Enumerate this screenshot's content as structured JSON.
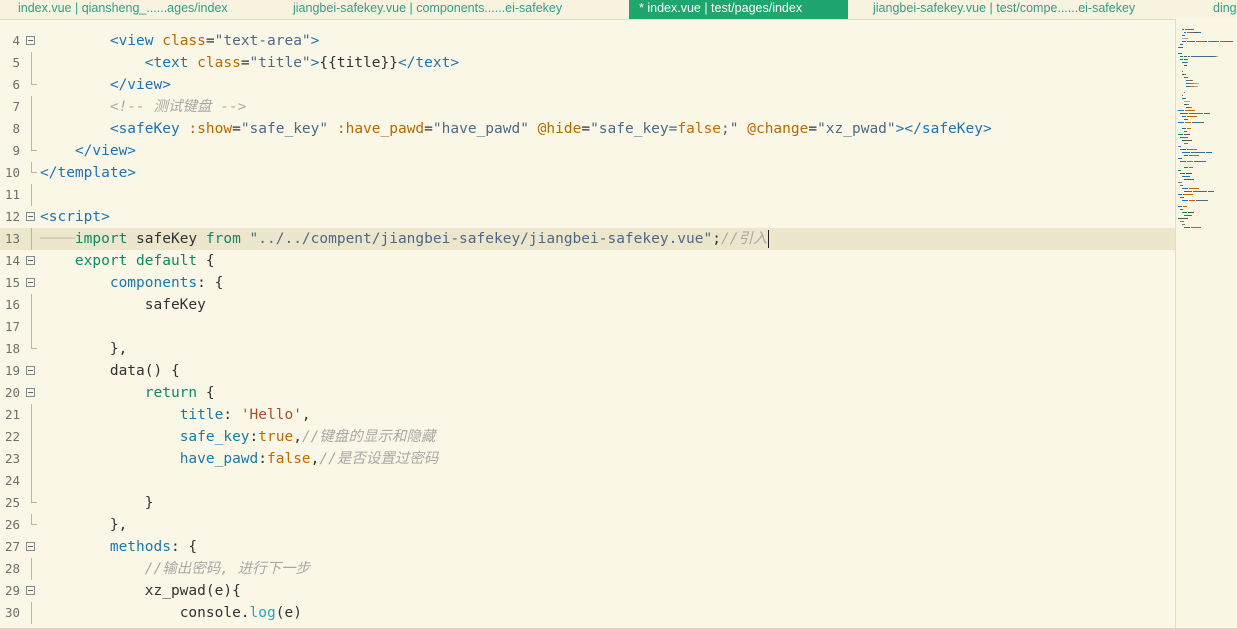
{
  "tabs": [
    {
      "label": "index.vue | qiansheng_......ages/index",
      "active": false
    },
    {
      "label": "jiangbei-safekey.vue | components......ei-safekey",
      "active": false
    },
    {
      "label": "* index.vue | test/pages/index",
      "active": true
    },
    {
      "label": "jiangbei-safekey.vue | test/compe......ei-safekey",
      "active": false
    },
    {
      "label": "ding",
      "active": false
    }
  ],
  "colors": {
    "background": "#fbf7e6",
    "active_tab": "#1ea66d",
    "tag": "#1a74b5",
    "attribute": "#b36a00",
    "string": "#4b6a87",
    "comment": "#a8a8a8",
    "keyword": "#0a8a66",
    "current_line": "#ece6cc"
  },
  "editor": {
    "current_line": "13",
    "lines": [
      {
        "num": "4",
        "indent": "        ",
        "fold": true,
        "tokens": [
          [
            "t-tag",
            "<view"
          ],
          [
            "t-punc",
            " "
          ],
          [
            "t-attr",
            "class"
          ],
          [
            "t-punc",
            "="
          ],
          [
            "t-str",
            "\"text-area\""
          ],
          [
            "t-tag",
            ">"
          ]
        ]
      },
      {
        "num": "5",
        "indent": "            ",
        "fold": false,
        "tokens": [
          [
            "t-tag",
            "<text"
          ],
          [
            "t-punc",
            " "
          ],
          [
            "t-attr",
            "class"
          ],
          [
            "t-punc",
            "="
          ],
          [
            "t-str",
            "\"title\""
          ],
          [
            "t-tag",
            ">"
          ],
          [
            "t-id",
            "{{title}}"
          ],
          [
            "t-tag",
            "</text>"
          ]
        ]
      },
      {
        "num": "6",
        "indent": "        ",
        "fold": false,
        "tokens": [
          [
            "t-tag",
            "</view>"
          ]
        ]
      },
      {
        "num": "7",
        "indent": "        ",
        "fold": false,
        "tokens": [
          [
            "t-com",
            "<!-- 测试键盘 -->"
          ]
        ]
      },
      {
        "num": "8",
        "indent": "        ",
        "fold": false,
        "tokens": [
          [
            "t-tag",
            "<safeKey"
          ],
          [
            "t-punc",
            " "
          ],
          [
            "t-attr",
            ":show"
          ],
          [
            "t-punc",
            "="
          ],
          [
            "t-str",
            "\"safe_key\""
          ],
          [
            "t-punc",
            " "
          ],
          [
            "t-attr",
            ":have_pawd"
          ],
          [
            "t-punc",
            "="
          ],
          [
            "t-str",
            "\"have_pawd\""
          ],
          [
            "t-punc",
            " "
          ],
          [
            "t-attr",
            "@hide"
          ],
          [
            "t-punc",
            "="
          ],
          [
            "t-str",
            "\"safe_key="
          ],
          [
            "t-bool",
            "false"
          ],
          [
            "t-str",
            ";\""
          ],
          [
            "t-punc",
            " "
          ],
          [
            "t-attr",
            "@change"
          ],
          [
            "t-punc",
            "="
          ],
          [
            "t-str",
            "\"xz_pwad\""
          ],
          [
            "t-tag",
            "></safeKey>"
          ]
        ]
      },
      {
        "num": "9",
        "indent": "    ",
        "fold": false,
        "tokens": [
          [
            "t-tag",
            "</view>"
          ]
        ]
      },
      {
        "num": "10",
        "indent": "",
        "fold": false,
        "tokens": [
          [
            "t-tag",
            "</template>"
          ]
        ]
      },
      {
        "num": "11",
        "indent": "",
        "fold": false,
        "tokens": []
      },
      {
        "num": "12",
        "indent": "",
        "fold": true,
        "tokens": [
          [
            "t-tag",
            "<script>"
          ]
        ]
      },
      {
        "num": "13",
        "indent": "    ",
        "fold": false,
        "current": true,
        "tokens": [
          [
            "t-kw",
            "import"
          ],
          [
            "t-punc",
            " "
          ],
          [
            "t-id",
            "safeKey"
          ],
          [
            "t-punc",
            " "
          ],
          [
            "t-kw",
            "from"
          ],
          [
            "t-punc",
            " "
          ],
          [
            "t-str",
            "\"../../compent/jiangbei-safekey/jiangbei-safekey.vue\""
          ],
          [
            "t-punc",
            ";"
          ],
          [
            "t-com",
            "//引入"
          ]
        ]
      },
      {
        "num": "14",
        "indent": "    ",
        "fold": true,
        "tokens": [
          [
            "t-kw",
            "export"
          ],
          [
            "t-punc",
            " "
          ],
          [
            "t-kw",
            "default"
          ],
          [
            "t-punc",
            " {"
          ]
        ]
      },
      {
        "num": "15",
        "indent": "        ",
        "fold": true,
        "tokens": [
          [
            "t-key",
            "components"
          ],
          [
            "t-punc",
            ": {"
          ]
        ]
      },
      {
        "num": "16",
        "indent": "            ",
        "fold": false,
        "tokens": [
          [
            "t-id",
            "safeKey"
          ]
        ]
      },
      {
        "num": "17",
        "indent": "",
        "fold": false,
        "tokens": []
      },
      {
        "num": "18",
        "indent": "        ",
        "fold": false,
        "tokens": [
          [
            "t-punc",
            "},"
          ]
        ]
      },
      {
        "num": "19",
        "indent": "        ",
        "fold": true,
        "tokens": [
          [
            "t-id",
            "data"
          ],
          [
            "t-punc",
            "() {"
          ]
        ]
      },
      {
        "num": "20",
        "indent": "            ",
        "fold": true,
        "tokens": [
          [
            "t-kw",
            "return"
          ],
          [
            "t-punc",
            " {"
          ]
        ]
      },
      {
        "num": "21",
        "indent": "                ",
        "fold": false,
        "tokens": [
          [
            "t-key",
            "title"
          ],
          [
            "t-punc",
            ": "
          ],
          [
            "t-sq",
            "'Hello'"
          ],
          [
            "t-punc",
            ","
          ]
        ]
      },
      {
        "num": "22",
        "indent": "                ",
        "fold": false,
        "tokens": [
          [
            "t-key",
            "safe_key"
          ],
          [
            "t-punc",
            ":"
          ],
          [
            "t-bool",
            "true"
          ],
          [
            "t-punc",
            ","
          ],
          [
            "t-com",
            "//键盘的显示和隐藏"
          ]
        ]
      },
      {
        "num": "23",
        "indent": "                ",
        "fold": false,
        "tokens": [
          [
            "t-key",
            "have_pawd"
          ],
          [
            "t-punc",
            ":"
          ],
          [
            "t-bool",
            "false"
          ],
          [
            "t-punc",
            ","
          ],
          [
            "t-com",
            "//是否设置过密码"
          ]
        ]
      },
      {
        "num": "24",
        "indent": "",
        "fold": false,
        "tokens": []
      },
      {
        "num": "25",
        "indent": "            ",
        "fold": false,
        "tokens": [
          [
            "t-punc",
            "}"
          ]
        ]
      },
      {
        "num": "26",
        "indent": "        ",
        "fold": false,
        "tokens": [
          [
            "t-punc",
            "},"
          ]
        ]
      },
      {
        "num": "27",
        "indent": "        ",
        "fold": true,
        "tokens": [
          [
            "t-key",
            "methods"
          ],
          [
            "t-punc",
            ": {"
          ]
        ]
      },
      {
        "num": "28",
        "indent": "            ",
        "fold": false,
        "tokens": [
          [
            "t-com",
            "//输出密码, 进行下一步"
          ]
        ]
      },
      {
        "num": "29",
        "indent": "            ",
        "fold": true,
        "tokens": [
          [
            "t-id",
            "xz_pwad"
          ],
          [
            "t-punc",
            "(e){"
          ]
        ]
      },
      {
        "num": "30",
        "indent": "                ",
        "fold": false,
        "tokens": [
          [
            "t-id",
            "console"
          ],
          [
            "t-punc",
            "."
          ],
          [
            "t-fn",
            "log"
          ],
          [
            "t-punc",
            "(e)"
          ]
        ]
      }
    ]
  }
}
